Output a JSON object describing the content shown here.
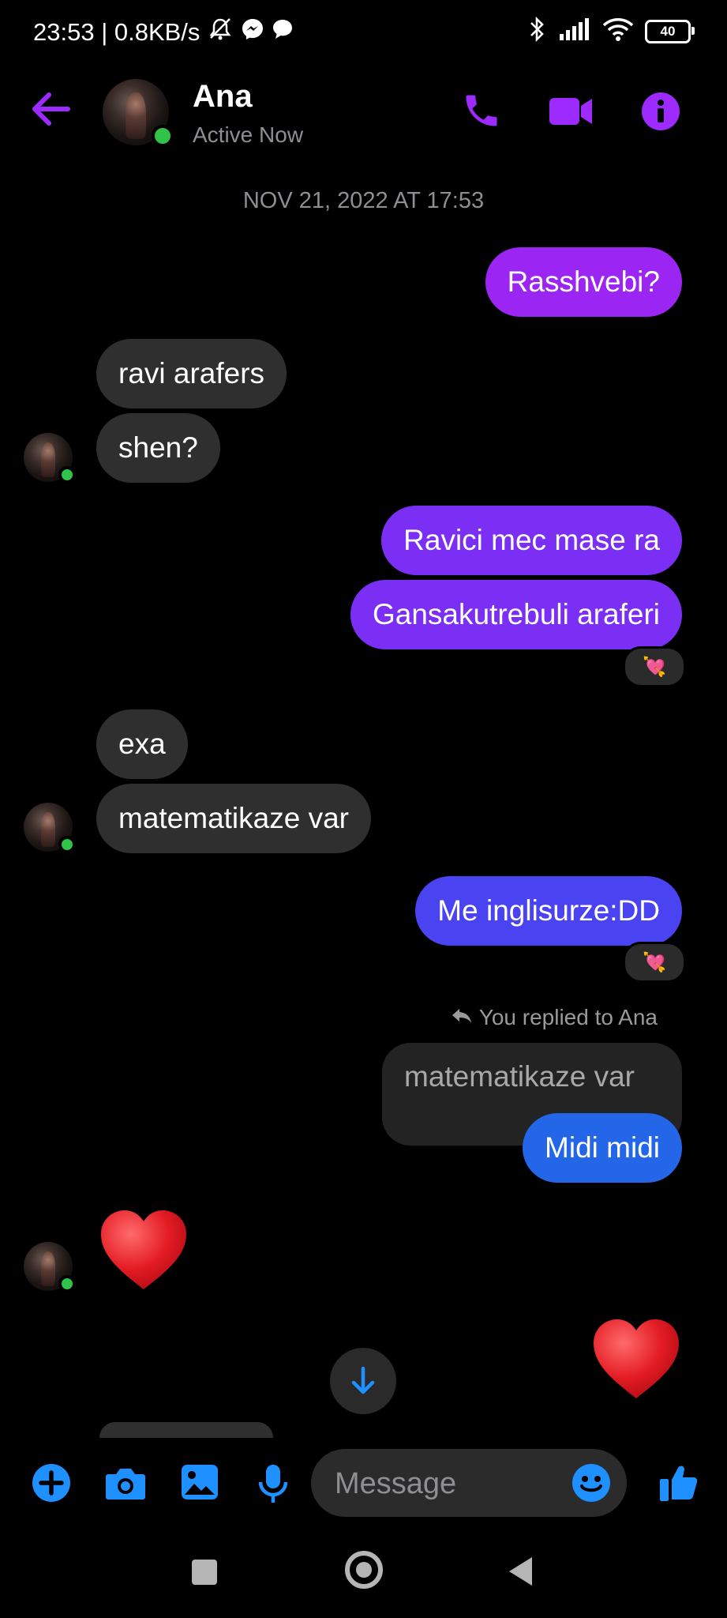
{
  "status_bar": {
    "time_speed": "23:53 | 0.8KB/s",
    "battery": "40"
  },
  "header": {
    "name": "Ana",
    "status": "Active Now"
  },
  "timestamp": "NOV 21, 2022 AT 17:53",
  "messages": [
    {
      "side": "out",
      "text": "Rasshvebi?"
    },
    {
      "side": "in",
      "text": "ravi arafers"
    },
    {
      "side": "in",
      "text": "shen?"
    },
    {
      "side": "out",
      "text": "Ravici mec mase ra"
    },
    {
      "side": "out",
      "text": "Gansakutrebuli araferi"
    },
    {
      "side": "in",
      "text": "exa"
    },
    {
      "side": "in",
      "text": "matematikaze var"
    },
    {
      "side": "out",
      "text": "Me inglisurze:DD"
    },
    {
      "side": "out",
      "text": "Midi midi"
    }
  ],
  "reactions": [
    "💘",
    "💘"
  ],
  "reply": {
    "label": "You replied to Ana",
    "quoted": "matematikaze var"
  },
  "hearts": [
    "❤️",
    "❤️"
  ],
  "composer": {
    "placeholder": "Message"
  },
  "colors": {
    "header_accent": "#9d2bff",
    "composer_accent": "#1e90ff",
    "online": "#31c24a"
  }
}
